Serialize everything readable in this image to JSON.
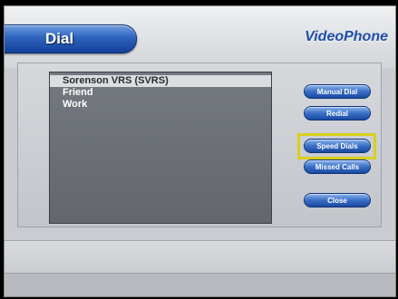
{
  "header": {
    "dial_title": "Dial",
    "brand": "VideoPhone"
  },
  "speed_dial_list": {
    "items": [
      {
        "label": "Sorenson VRS (SVRS)",
        "selected": true
      },
      {
        "label": "Friend",
        "selected": false
      },
      {
        "label": "Work",
        "selected": false
      }
    ]
  },
  "buttons": {
    "manual_dial": "Manual Dial",
    "redial": "Redial",
    "speed_dials": "Speed Dials",
    "missed_calls": "Missed Calls",
    "close": "Close"
  },
  "focused_button": "speed_dials",
  "colors": {
    "accent_blue": "#2e63bd",
    "brand_text": "#1f4fa8",
    "focus_ring": "#d9cf1c",
    "list_background": "#6b6f75"
  }
}
